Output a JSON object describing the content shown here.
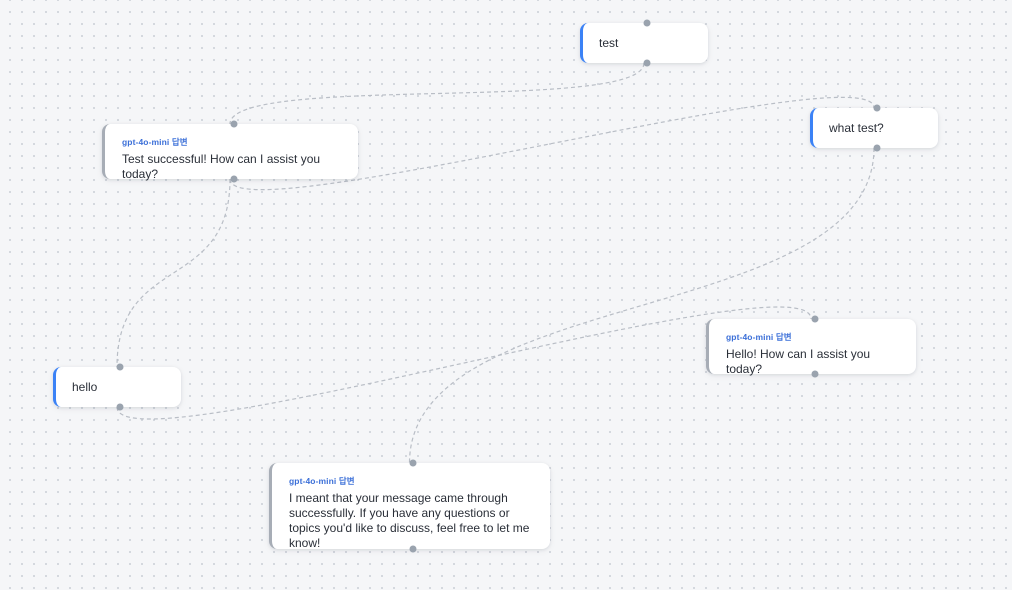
{
  "canvas": {
    "nodes": [
      {
        "id": "n-test",
        "role": "user",
        "text": "test"
      },
      {
        "id": "n-ans1",
        "role": "assistant",
        "label": "gpt-4o-mini 답변",
        "text": "Test successful! How can I assist you today?"
      },
      {
        "id": "n-whattest",
        "role": "user",
        "text": "what test?"
      },
      {
        "id": "n-hello",
        "role": "user",
        "text": "hello"
      },
      {
        "id": "n-ans2",
        "role": "assistant",
        "label": "gpt-4o-mini 답변",
        "text": "Hello! How can I assist you today?"
      },
      {
        "id": "n-ans3",
        "role": "assistant",
        "label": "gpt-4o-mini 답변",
        "text": "I meant that your message came through successfully. If you have any questions or topics you'd like to discuss, feel free to let me know!"
      }
    ],
    "edges": [
      [
        "n-test",
        "n-ans1"
      ],
      [
        "n-ans1",
        "n-whattest"
      ],
      [
        "n-ans1",
        "n-hello"
      ],
      [
        "n-whattest",
        "n-ans3"
      ],
      [
        "n-hello",
        "n-ans2"
      ]
    ]
  }
}
